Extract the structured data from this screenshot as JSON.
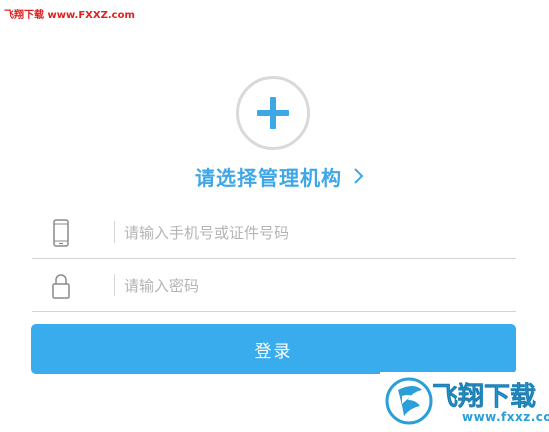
{
  "watermark_top": {
    "text": "飞翔下载 www.FXXZ.com",
    "color": "#e02020"
  },
  "org_selector": {
    "add_icon": "plus-icon",
    "label": "请选择管理机构",
    "chevron_icon": "chevron-right-icon",
    "accent_color": "#3fa7e6"
  },
  "phone_field": {
    "icon": "phone-icon",
    "value": "",
    "placeholder": "请输入手机号或证件号码"
  },
  "password_field": {
    "icon": "lock-icon",
    "value": "",
    "placeholder": "请输入密码"
  },
  "login_button": {
    "label": "登录",
    "color": "#38acec"
  },
  "brand_watermark": {
    "name": "飞翔下载",
    "url": "www.fxxz.com",
    "logo_icon": "fxxz-logo-icon",
    "color": "#2a9fd8"
  }
}
